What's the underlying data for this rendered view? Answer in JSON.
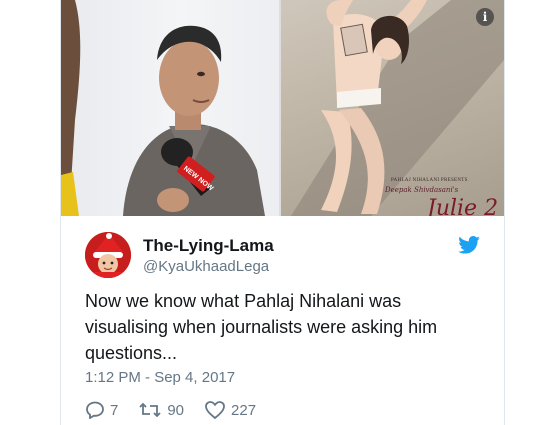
{
  "tweet": {
    "display_name": "The-Lying-Lama",
    "handle": "@KyaUkhaadLega",
    "text": "Now we know what Pahlaj Nihalani was visualising when journalists were asking him questions...",
    "timestamp": "1:12 PM - Sep 4, 2017",
    "replies": "7",
    "retweets": "90",
    "likes": "227"
  },
  "media": {
    "mic_label": "NEW NOW",
    "poster_credit": "PAHLAJ NIHALANI PRESENTS",
    "poster_credit2": "Deepak Shivdasani's",
    "poster_title": "Julie 2",
    "info_icon": "info-icon"
  },
  "colors": {
    "brand": "#1da1f2",
    "text": "#14171a",
    "muted": "#657786",
    "avatar_bg": "#c81d1d"
  }
}
